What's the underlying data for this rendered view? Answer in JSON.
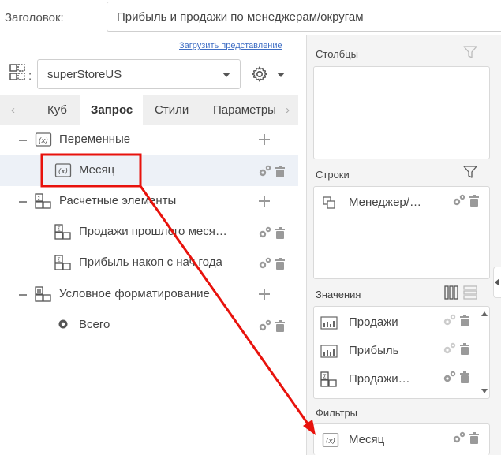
{
  "header": {
    "title_label": "Заголовок:",
    "title_value": "Прибыль и продажи по менеджерам/округам"
  },
  "left": {
    "load_link": "Загрузить представление",
    "cube_suffix": ":",
    "cube_selected": "superStoreUS",
    "tabs": [
      {
        "label": "Куб",
        "active": false
      },
      {
        "label": "Запрос",
        "active": true
      },
      {
        "label": "Стили",
        "active": false
      },
      {
        "label": "Параметры",
        "active": false
      }
    ],
    "tree": [
      {
        "label": "Переменные",
        "type": "group",
        "icon": "variable-icon"
      },
      {
        "label": "Месяц",
        "type": "item",
        "icon": "variable-icon",
        "selected": true,
        "highlighted": true
      },
      {
        "label": "Расчетные элементы",
        "type": "group",
        "icon": "calculated-icon"
      },
      {
        "label": "Продажи прошлого меся…",
        "type": "item",
        "icon": "calculated-icon"
      },
      {
        "label": "Прибыль накоп с нач года",
        "type": "item",
        "icon": "calculated-icon"
      },
      {
        "label": "Условное форматирование",
        "type": "group",
        "icon": "conditional-format-icon"
      },
      {
        "label": "Всего",
        "type": "item",
        "icon": "radio-dot-icon"
      }
    ]
  },
  "right": {
    "columns_title": "Столбцы",
    "rows_title": "Строки",
    "rows_items": [
      {
        "label": "Менеджер/…",
        "icon": "hierarchy-icon"
      }
    ],
    "values_title": "Значения",
    "values_items": [
      {
        "label": "Продажи",
        "icon": "measure-icon"
      },
      {
        "label": "Прибыль",
        "icon": "measure-icon"
      },
      {
        "label": "Продажи…",
        "icon": "calculated-icon"
      }
    ],
    "filters_title": "Фильтры",
    "filters_items": [
      {
        "label": "Месяц",
        "icon": "variable-icon"
      }
    ]
  },
  "annotation": {
    "color": "#e8120c",
    "arrow": "from highlighted item Месяц to Фильтры section"
  }
}
